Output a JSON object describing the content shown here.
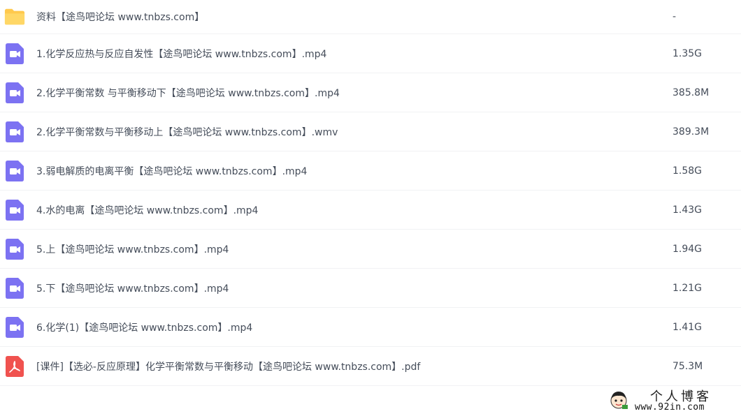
{
  "files": [
    {
      "icon": "folder-icon",
      "name": "资料【途鸟吧论坛 www.tnbzs.com】",
      "size": "-"
    },
    {
      "icon": "video-icon",
      "name": "1.化学反应热与反应自发性【途鸟吧论坛 www.tnbzs.com】.mp4",
      "size": "1.35G"
    },
    {
      "icon": "video-icon",
      "name": "2.化学平衡常数 与平衡移动下【途鸟吧论坛 www.tnbzs.com】.mp4",
      "size": "385.8M"
    },
    {
      "icon": "video-icon",
      "name": "2.化学平衡常数与平衡移动上【途鸟吧论坛 www.tnbzs.com】.wmv",
      "size": "389.3M"
    },
    {
      "icon": "video-icon",
      "name": "3.弱电解质的电离平衡【途鸟吧论坛 www.tnbzs.com】.mp4",
      "size": "1.58G"
    },
    {
      "icon": "video-icon",
      "name": "4.水的电离【途鸟吧论坛 www.tnbzs.com】.mp4",
      "size": "1.43G"
    },
    {
      "icon": "video-icon",
      "name": "5.上【途鸟吧论坛 www.tnbzs.com】.mp4",
      "size": "1.94G"
    },
    {
      "icon": "video-icon",
      "name": "5.下【途鸟吧论坛 www.tnbzs.com】.mp4",
      "size": "1.21G"
    },
    {
      "icon": "video-icon",
      "name": "6.化学(1)【途鸟吧论坛 www.tnbzs.com】.mp4",
      "size": "1.41G"
    },
    {
      "icon": "pdf-icon",
      "name": "[课件]【选必-反应原理】化学平衡常数与平衡移动【途鸟吧论坛 www.tnbzs.com】.pdf",
      "size": "75.3M"
    }
  ],
  "watermark": {
    "title": "个人博客",
    "url": "www.92in.com"
  },
  "colors": {
    "folder": "#ffc94d",
    "video": "#7c72f2",
    "pdf": "#f0524f"
  }
}
